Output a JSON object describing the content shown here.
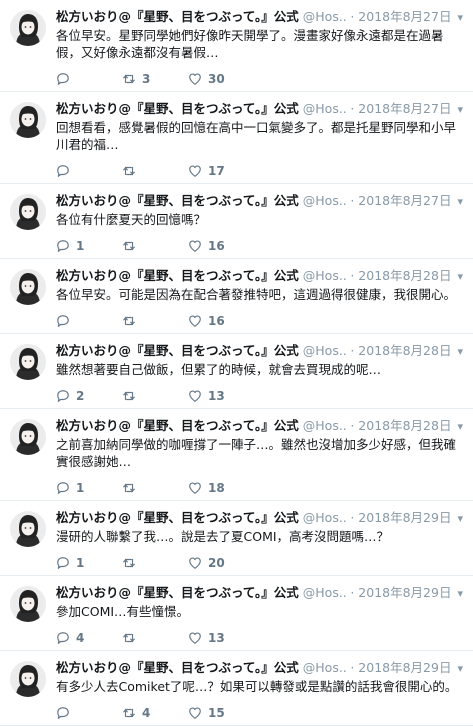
{
  "author": {
    "name": "松方いおり@『星野、目をつぶって。』公式",
    "handle": "@Hos...",
    "avatar_icon": "avatar-icon"
  },
  "tweets": [
    {
      "date": "2018年8月27日",
      "text": "各位早安。星野同學她們好像昨天開學了。漫畫家好像永遠都是在過暑假，又好像永遠都沒有暑假…",
      "replies": "",
      "retweets": "3",
      "likes": "30"
    },
    {
      "date": "2018年8月27日",
      "text": "回想看看，感覺暑假的回憶在高中一口氣變多了。都是托星野同學和小早川君的福…",
      "replies": "",
      "retweets": "",
      "likes": "17"
    },
    {
      "date": "2018年8月27日",
      "text": "各位有什麼夏天的回憶嗎？",
      "replies": "1",
      "retweets": "",
      "likes": "16"
    },
    {
      "date": "2018年8月28日",
      "text": "各位早安。可能是因為在配合著發推特吧，這週過得很健康，我很開心。",
      "replies": "",
      "retweets": "",
      "likes": "16"
    },
    {
      "date": "2018年8月28日",
      "text": "雖然想著要自己做飯，但累了的時候，就會去買現成的呢…",
      "replies": "2",
      "retweets": "",
      "likes": "13"
    },
    {
      "date": "2018年8月28日",
      "text": "之前喜加納同學做的咖喱撐了一陣子…。雖然也沒增加多少好感，但我確實很感謝她…",
      "replies": "1",
      "retweets": "",
      "likes": "18"
    },
    {
      "date": "2018年8月29日",
      "text": "漫研的人聯繫了我…。說是去了夏COMI，高考沒問題嗎…？",
      "replies": "1",
      "retweets": "",
      "likes": "20"
    },
    {
      "date": "2018年8月29日",
      "text": "參加COMI…有些憧憬。",
      "replies": "4",
      "retweets": "",
      "likes": "13"
    },
    {
      "date": "2018年8月29日",
      "text": "有多少人去Comiket了呢…？如果可以轉發或是點讚的話我會很開心的。",
      "replies": "",
      "retweets": "4",
      "likes": "15"
    }
  ],
  "icons": {
    "reply": "reply-icon",
    "retweet": "retweet-icon",
    "like": "heart-icon",
    "menu": "chevron-down-icon"
  },
  "colors": {
    "text": "#14171a",
    "muted": "#8899a6",
    "action": "#657786",
    "divider": "#e6ecf0"
  }
}
